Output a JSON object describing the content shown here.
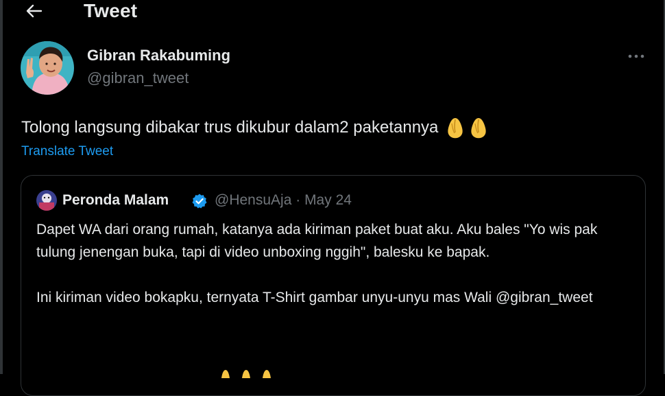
{
  "header": {
    "title": "Tweet",
    "back_icon": "arrow-left-icon"
  },
  "author": {
    "name": "Gibran Rakabuming",
    "handle": "@gibran_tweet"
  },
  "tweet": {
    "text": "Tolong langsung dibakar trus dikubur dalam2 paketannya",
    "emoji": [
      "pinched-fingers",
      "pinched-fingers"
    ],
    "translate_label": "Translate Tweet"
  },
  "quote": {
    "name": "Peronda Malam",
    "verified": true,
    "handle": "@HensuAja",
    "separator": "·",
    "date": "May 24",
    "paragraph_1": "Dapet WA dari orang rumah, katanya ada kiriman paket buat aku. Aku bales \"Yo wis pak tulung jenengan buka, tapi di video unboxing nggih\", balesku ke bapak.",
    "paragraph_2": "Ini kiriman video bokapku, ternyata T-Shirt gambar unyu-unyu mas Wali @gibran_tweet"
  },
  "colors": {
    "background": "#000000",
    "text": "#e7e9ea",
    "muted": "#71767b",
    "link": "#1d9bf0",
    "border": "#2f3336"
  }
}
